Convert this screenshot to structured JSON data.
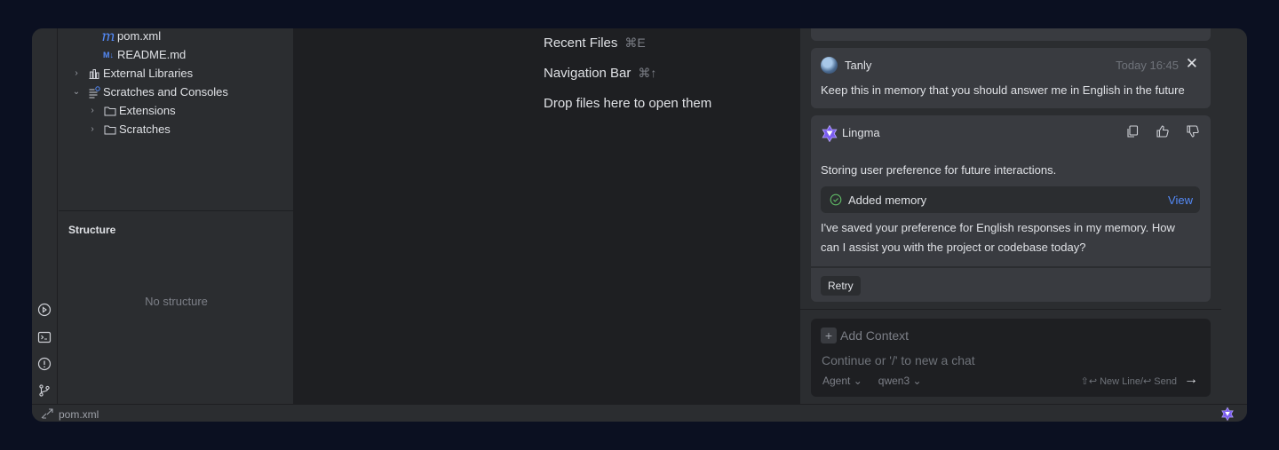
{
  "project_tree": {
    "items": [
      {
        "label": "pom.xml",
        "icon": "maven-icon"
      },
      {
        "label": "README.md",
        "icon": "markdown-icon"
      },
      {
        "label": "External Libraries",
        "icon": "library-icon"
      },
      {
        "label": "Scratches and Consoles",
        "icon": "scratches-icon"
      },
      {
        "label": "Extensions",
        "icon": "folder-icon"
      },
      {
        "label": "Scratches",
        "icon": "folder-icon"
      }
    ]
  },
  "structure": {
    "title": "Structure",
    "empty_text": "No structure"
  },
  "editor_hints": [
    {
      "label": "Recent Files",
      "shortcut": "⌘E"
    },
    {
      "label": "Navigation Bar",
      "shortcut": "⌘↑"
    },
    {
      "label": "Drop files here to open them",
      "shortcut": ""
    }
  ],
  "chat": {
    "user_message": {
      "author": "Tanly",
      "time": "Today 16:45",
      "text": "Keep this in memory that you should answer me in English in the future"
    },
    "bot_message": {
      "author": "Lingma",
      "text1": "Storing user preference for future interactions.",
      "memory_label": "Added memory",
      "memory_view": "View",
      "text2": "I've saved your preference for English responses in my memory. How can I assist you with the project or codebase today?",
      "retry_label": "Retry"
    },
    "input": {
      "add_context": "Add Context",
      "placeholder": "Continue or '/' to new a chat",
      "mode": "Agent",
      "model": "qwen3",
      "send_hint": "⇧↩ New Line/↩ Send"
    }
  },
  "status_bar": {
    "file": "pom.xml"
  },
  "colors": {
    "accent": "#548af7",
    "panel": "#2b2d30",
    "editor": "#1e1f22",
    "card": "#393b40"
  }
}
